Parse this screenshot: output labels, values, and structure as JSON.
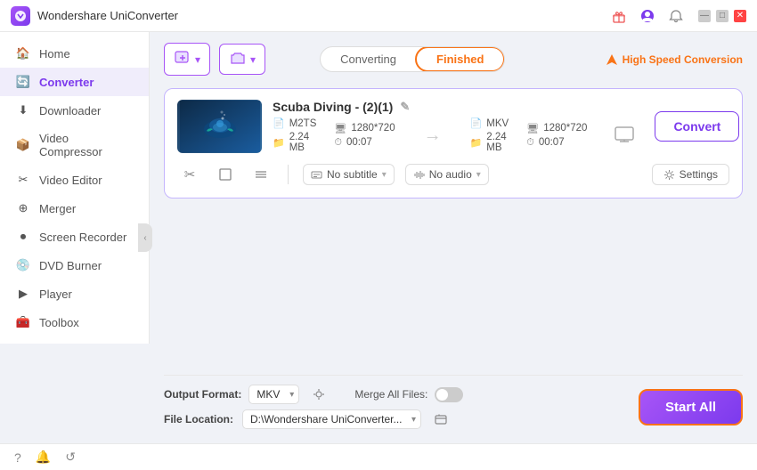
{
  "app": {
    "title": "Wondershare UniConverter",
    "logo_text": "W"
  },
  "titlebar": {
    "icons": [
      "gift-icon",
      "user-icon",
      "bell-icon",
      "minimize-icon",
      "maximize-icon",
      "close-icon"
    ]
  },
  "sidebar": {
    "items": [
      {
        "id": "home",
        "label": "Home",
        "icon": "🏠"
      },
      {
        "id": "converter",
        "label": "Converter",
        "icon": "🔄",
        "active": true
      },
      {
        "id": "downloader",
        "label": "Downloader",
        "icon": "⬇"
      },
      {
        "id": "video-compressor",
        "label": "Video Compressor",
        "icon": "📦"
      },
      {
        "id": "video-editor",
        "label": "Video Editor",
        "icon": "✂"
      },
      {
        "id": "merger",
        "label": "Merger",
        "icon": "⊕"
      },
      {
        "id": "screen-recorder",
        "label": "Screen Recorder",
        "icon": "⏺"
      },
      {
        "id": "dvd-burner",
        "label": "DVD Burner",
        "icon": "💿"
      },
      {
        "id": "player",
        "label": "Player",
        "icon": "▶"
      },
      {
        "id": "toolbox",
        "label": "Toolbox",
        "icon": "🧰"
      }
    ]
  },
  "toolbar": {
    "add_btn_label": "",
    "add_files_label": "",
    "tabs": [
      {
        "id": "converting",
        "label": "Converting"
      },
      {
        "id": "finished",
        "label": "Finished",
        "active": true
      }
    ],
    "high_speed_label": "High Speed Conversion"
  },
  "file_card": {
    "title": "Scuba Diving - (2)(1)",
    "source": {
      "format": "M2TS",
      "resolution": "1280*720",
      "size": "2.24 MB",
      "duration": "00:07"
    },
    "target": {
      "format": "MKV",
      "resolution": "1280*720",
      "size": "2.24 MB",
      "duration": "00:07"
    },
    "convert_btn": "Convert",
    "subtitle_label": "No subtitle",
    "audio_label": "No audio",
    "settings_label": "Settings"
  },
  "bottom_bar": {
    "output_format_label": "Output Format:",
    "output_format_value": "MKV",
    "file_location_label": "File Location:",
    "file_location_value": "D:\\Wondershare UniConverter...",
    "merge_files_label": "Merge All Files:",
    "start_all_label": "Start All"
  },
  "status_bar": {
    "icons": [
      "help-icon",
      "notification-icon",
      "feedback-icon"
    ]
  }
}
